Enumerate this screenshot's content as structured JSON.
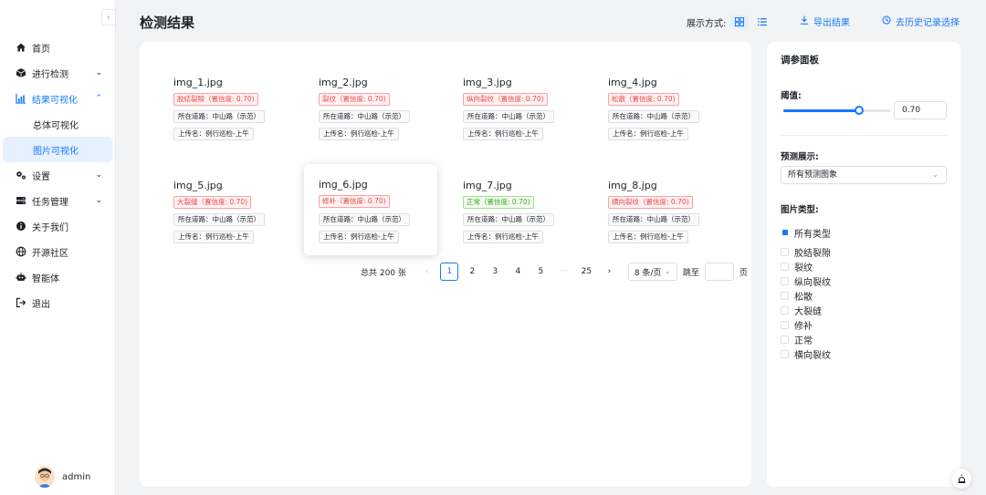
{
  "header": {
    "title": "检测结果",
    "display_mode_label": "展示方式:",
    "export_label": "导出结果",
    "history_label": "去历史记录选择"
  },
  "sidebar": {
    "collapse_icon": "chevron-left-icon",
    "items": [
      {
        "label": "首页",
        "icon": "home-icon"
      },
      {
        "label": "进行检测",
        "icon": "cube-icon"
      },
      {
        "label": "结果可视化",
        "icon": "chart-icon"
      },
      {
        "label": "总体可视化"
      },
      {
        "label": "图片可视化"
      },
      {
        "label": "设置",
        "icon": "gears-icon"
      },
      {
        "label": "任务管理",
        "icon": "server-icon"
      },
      {
        "label": "关于我们",
        "icon": "info-icon"
      },
      {
        "label": "开源社区",
        "icon": "globe-icon"
      },
      {
        "label": "智能体",
        "icon": "robot-icon"
      },
      {
        "label": "退出",
        "icon": "logout-icon"
      }
    ],
    "user": {
      "name": "admin"
    }
  },
  "cards": [
    {
      "file": "img_1.jpg",
      "tag": "胶结裂隙（置信度: 0.70)",
      "road": "所在道路：中山路（示范）",
      "uploader": "上传名：例行巡检-上午"
    },
    {
      "file": "img_2.jpg",
      "tag": "裂纹（置信度: 0.70)",
      "road": "所在道路：中山路（示范）",
      "uploader": "上传名：例行巡检-上午"
    },
    {
      "file": "img_3.jpg",
      "tag": "纵向裂纹（置信度: 0.70)",
      "road": "所在道路：中山路（示范）",
      "uploader": "上传名：例行巡检-上午"
    },
    {
      "file": "img_4.jpg",
      "tag": "松散（置信度: 0.70)",
      "road": "所在道路：中山路（示范）",
      "uploader": "上传名：例行巡检-上午"
    },
    {
      "file": "img_5.jpg",
      "tag": "大裂缝（置信度: 0.70)",
      "road": "所在道路：中山路（示范）",
      "uploader": "上传名：例行巡检-上午"
    },
    {
      "file": "img_6.jpg",
      "tag": "修补（置信度: 0.70)",
      "road": "所在道路：中山路（示范）",
      "uploader": "上传名：例行巡检-上午"
    },
    {
      "file": "img_7.jpg",
      "tag": "正常（置信度: 0.70)",
      "road": "所在道路：中山路（示范）",
      "uploader": "上传名：例行巡检-上午"
    },
    {
      "file": "img_8.jpg",
      "tag": "横向裂纹（置信度: 0.70)",
      "road": "所在道路：中山路（示范）",
      "uploader": "上传名：例行巡检-上午"
    }
  ],
  "pagination": {
    "total": "总共 200 张",
    "pages": [
      "1",
      "2",
      "3",
      "4",
      "5",
      "···",
      "25"
    ],
    "current": "1",
    "page_size": "8 条/页",
    "jump_label": "跳至",
    "page_unit": "页"
  },
  "params": {
    "title": "调参面板",
    "threshold_label": "阈值:",
    "threshold_value": "0.70",
    "threshold_fraction": 0.7,
    "prediction_label": "预测展示:",
    "prediction_value": "所有预测图象",
    "type_label": "图片类型:",
    "types": [
      "所有类型",
      "胶结裂隙",
      "裂纹",
      "纵向裂纹",
      "松散",
      "大裂缝",
      "修补",
      "正常",
      "横向裂纹"
    ],
    "checked_type": "所有类型"
  },
  "colors": {
    "accent": "#1677ff",
    "danger": "#e5484d",
    "success": "#3aa72f"
  }
}
